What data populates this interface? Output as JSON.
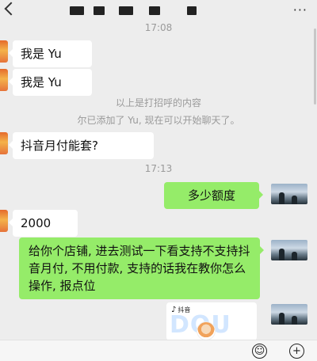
{
  "timestamps": {
    "first": "17:08",
    "second": "17:13"
  },
  "system_messages": {
    "greeting_note": "以上是打招呼的内容",
    "added_note": "尔已添加了 Yu, 现在可以开始聊天了。"
  },
  "messages": {
    "m1": "我是 Yu",
    "m2": "我是 Yu",
    "m3": "抖音月付能套?",
    "m4": "多少额度",
    "m5": "2000",
    "m6": "给你个店铺, 进去测试一下看支持不支持抖音月付, 不用付款, 支持的话我在教你怎么操作, 报点位"
  },
  "share_card": {
    "brand": "抖音",
    "logo_text": "DOU"
  },
  "icons": {
    "back": "chevron-left-icon",
    "more": "more-dots-icon",
    "emoji": "emoji-icon",
    "add": "plus-circle-icon",
    "douyin": "douyin-note-icon"
  },
  "colors": {
    "outgoing_bubble": "#95ec69",
    "incoming_bubble": "#ffffff",
    "background": "#ededed"
  }
}
